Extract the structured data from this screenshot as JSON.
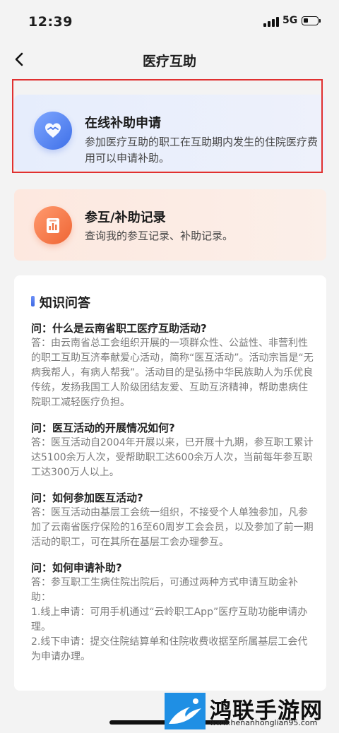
{
  "status_bar": {
    "time": "12:39",
    "network": "5G"
  },
  "nav": {
    "title": "医疗互助"
  },
  "cards": [
    {
      "title": "在线补助申请",
      "desc": "参加医疗互助的职工在互助期内发生的住院医疗费用可以申请补助。",
      "icon": "heart-hands-icon",
      "color": "#4a78ec"
    },
    {
      "title": "参互/补助记录",
      "desc": "查询我的参互记录、补助记录。",
      "icon": "record-list-icon",
      "color": "#f0703e"
    }
  ],
  "knowledge": {
    "title": "知识问答",
    "items": [
      {
        "q": "问：什么是云南省职工医疗互助活动?",
        "a": "答：由云南省总工会组织开展的一项群众性、公益性、非营利性的职工互助互济奉献爱心活动，简称“医互活动”。活动宗旨是“无病我帮人，有病人帮我”。活动目的是弘扬中华民族助人为乐优良传统，发扬我国工人阶级团结友爱、互助互济精神，帮助患病住院职工减轻医疗负担。"
      },
      {
        "q": "问：医互活动的开展情况如何?",
        "a": "答：医互活动自2004年开展以来，已开展十九期，参互职工累计达5100余万人次，受帮助职工达600余万人次，当前每年参互职工达300万人以上。"
      },
      {
        "q": "问：如何参加医互活动?",
        "a": "答：医互活动由基层工会统一组织，不接受个人单独参加，凡参加了云南省医疗保险的16至60周岁工会会员，以及参加了前一期活动的职工，可在其所在基层工会办理参互。"
      },
      {
        "q": "问：如何申请补助?",
        "a": "答：参互职工生病住院出院后，可通过两种方式申请互助金补助：",
        "extra": [
          "1.线上申请：可用手机通过“云岭职工App”医疗互助功能申请办理。",
          "2.线下申请：提交住院结算单和住院收费收据至所属基层工会代为申请办理。"
        ]
      }
    ]
  },
  "watermark": {
    "title": "鸿联手游网",
    "url": "www.henanhonglian95.com"
  }
}
